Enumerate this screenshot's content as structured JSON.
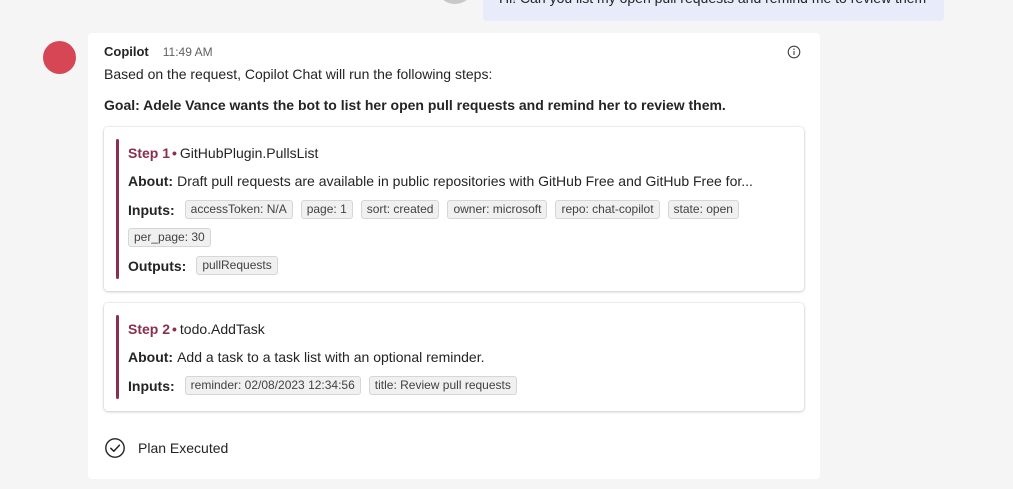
{
  "user_message": {
    "text": "Hi! Can you list my open pull requests and remind me to review them"
  },
  "bot": {
    "name": "Copilot",
    "time": "11:49 AM",
    "avatar_color": "#d74654",
    "intro": "Based on the request, Copilot Chat will run the following steps:",
    "goal": "Goal: Adele Vance wants the bot to list her open pull requests and remind her to review them."
  },
  "steps": [
    {
      "step_label": "Step 1",
      "dot": "•",
      "plugin": "GitHubPlugin.PullsList",
      "about_label": "About:",
      "about": "Draft pull requests are available in public repositories with GitHub Free and GitHub Free for...",
      "inputs_label": "Inputs:",
      "inputs": [
        "accessToken: N/A",
        "page: 1",
        "sort: created",
        "owner: microsoft",
        "repo: chat-copilot",
        "state: open",
        "per_page: 30"
      ],
      "outputs_label": "Outputs:",
      "outputs": [
        "pullRequests"
      ]
    },
    {
      "step_label": "Step 2",
      "dot": "•",
      "plugin": "todo.AddTask",
      "about_label": "About:",
      "about": "Add a task to a task list with an optional reminder.",
      "inputs_label": "Inputs:",
      "inputs": [
        "reminder: 02/08/2023 12:34:56",
        "title: Review pull requests"
      ]
    }
  ],
  "status": {
    "text": "Plan Executed",
    "icon": "check-circle-icon"
  },
  "colors": {
    "accent": "#8a2f4e",
    "user_bubble": "#e8ebfa",
    "background": "#f5f5f5"
  }
}
